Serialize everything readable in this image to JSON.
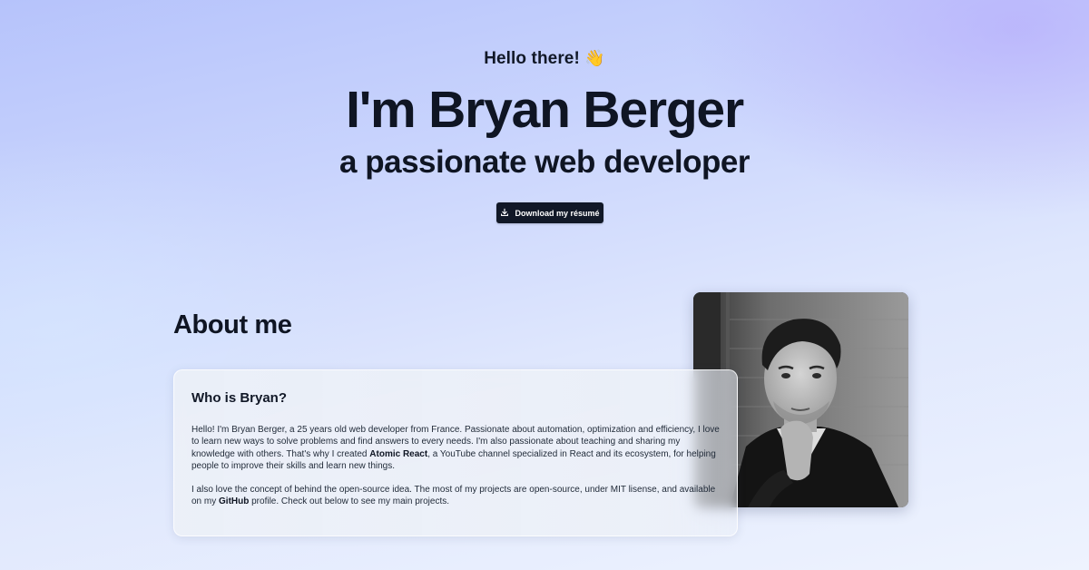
{
  "hero": {
    "greeting": "Hello there!",
    "wave_emoji": "👋",
    "name": "I'm Bryan Berger",
    "tagline": "a passionate web developer",
    "resume_button": {
      "label": "Download my résumé",
      "icon": "download-icon"
    }
  },
  "about": {
    "title": "About me",
    "photo_alt": "Bryan Berger portrait",
    "card": {
      "title": "Who is Bryan?",
      "paragraph1": {
        "part1": "Hello! I'm Bryan Berger, a 25 years old web developer from France. Passionate about automation, optimization and efficiency, I love to learn new ways to solve problems and find answers to every needs. I'm also passionate about teaching and sharing my knowledge with others. That's why I created ",
        "bold": "Atomic React",
        "part2": ", a YouTube channel specialized in React and its ecosystem, for helping people to improve their skills and learn new things."
      },
      "paragraph2": {
        "part1": "I also love the concept of behind the open-source idea. The most of my projects are open-source, under MIT lisense, and available on my ",
        "bold": "GitHub",
        "part2": " profile. Check out below to see my main projects."
      }
    }
  },
  "colors": {
    "text_primary": "#0f1523",
    "button_bg": "#111827",
    "button_text": "#ffffff",
    "bg_top": "#b6c3fb",
    "bg_bottom": "#eef3fe"
  }
}
